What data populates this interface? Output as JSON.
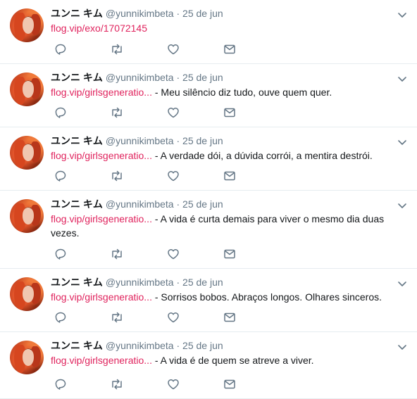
{
  "account": {
    "display_name": "ユンニ キム",
    "handle": "@yunnikimbeta"
  },
  "tweets": [
    {
      "date": "25 de jun",
      "link_text": "flog.vip/exo/17072145",
      "separator": "",
      "body": ""
    },
    {
      "date": "25 de jun",
      "link_text": "flog.vip/girlsgeneratio...",
      "separator": " - ",
      "body": "Meu silêncio diz tudo, ouve quem quer."
    },
    {
      "date": "25 de jun",
      "link_text": "flog.vip/girlsgeneratio...",
      "separator": " - ",
      "body": "A verdade dói, a dúvida corrói, a mentira destrói."
    },
    {
      "date": "25 de jun",
      "link_text": "flog.vip/girlsgeneratio...",
      "separator": " - ",
      "body": "A vida é curta demais para viver o mesmo dia duas vezes."
    },
    {
      "date": "25 de jun",
      "link_text": "flog.vip/girlsgeneratio...",
      "separator": " - ",
      "body": "Sorrisos bobos. Abraços longos. Olhares sinceros."
    },
    {
      "date": "25 de jun",
      "link_text": "flog.vip/girlsgeneratio...",
      "separator": " - ",
      "body": "A vida é de quem se atreve a viver."
    }
  ],
  "ui": {
    "dot": "·",
    "icons": [
      "reply-icon",
      "retweet-icon",
      "like-icon",
      "direct-message-icon",
      "chevron-down-icon"
    ],
    "icon_color": "#657786",
    "link_color": "#e0245e"
  }
}
